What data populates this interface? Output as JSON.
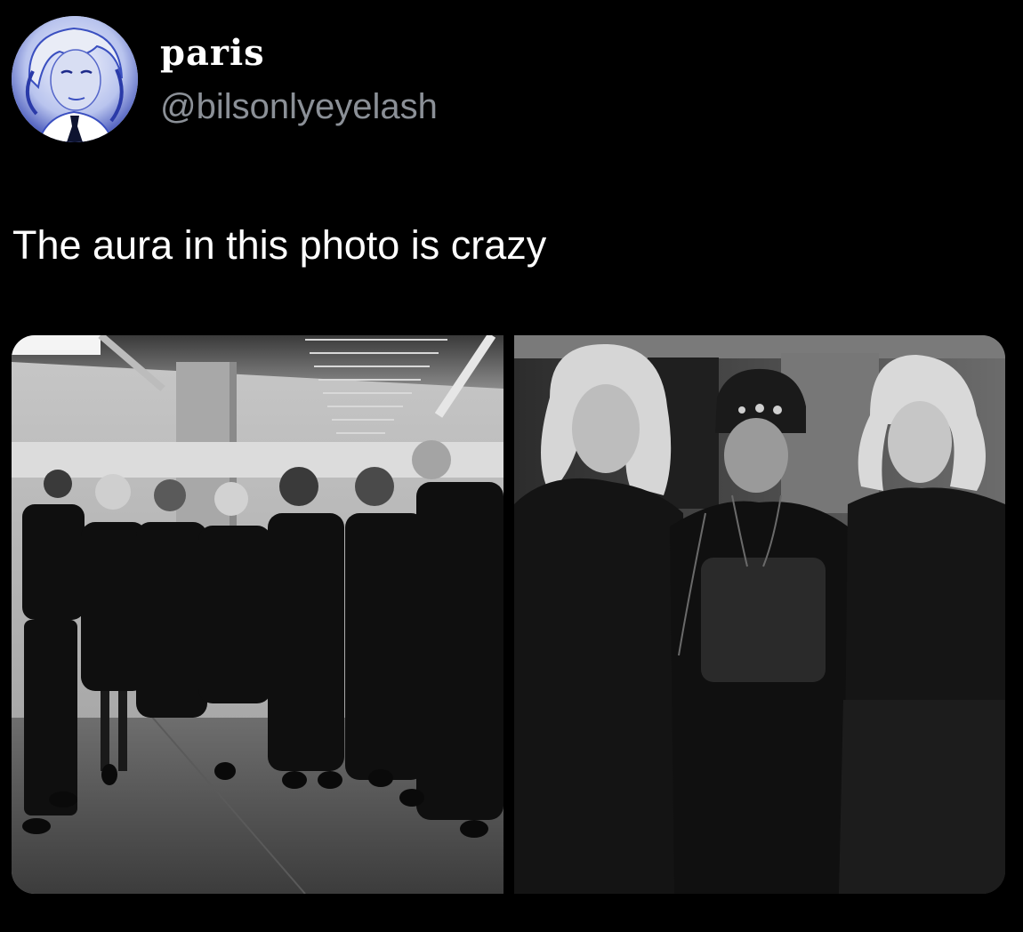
{
  "tweet": {
    "author": {
      "display_name": "paris",
      "handle": "@bilsonlyeyelash",
      "avatar_icon": "user-avatar-photo"
    },
    "text": "The aura in this photo is crazy",
    "media": [
      {
        "kind": "photo",
        "tone": "black-and-white",
        "subject": "group-photo-seven-people"
      },
      {
        "kind": "photo",
        "tone": "black-and-white",
        "subject": "three-people-close-up"
      }
    ]
  },
  "colors": {
    "background": "#000000",
    "text_primary": "#ffffff",
    "text_secondary": "#8b9097",
    "avatar_tint": "#3a4fc0"
  }
}
